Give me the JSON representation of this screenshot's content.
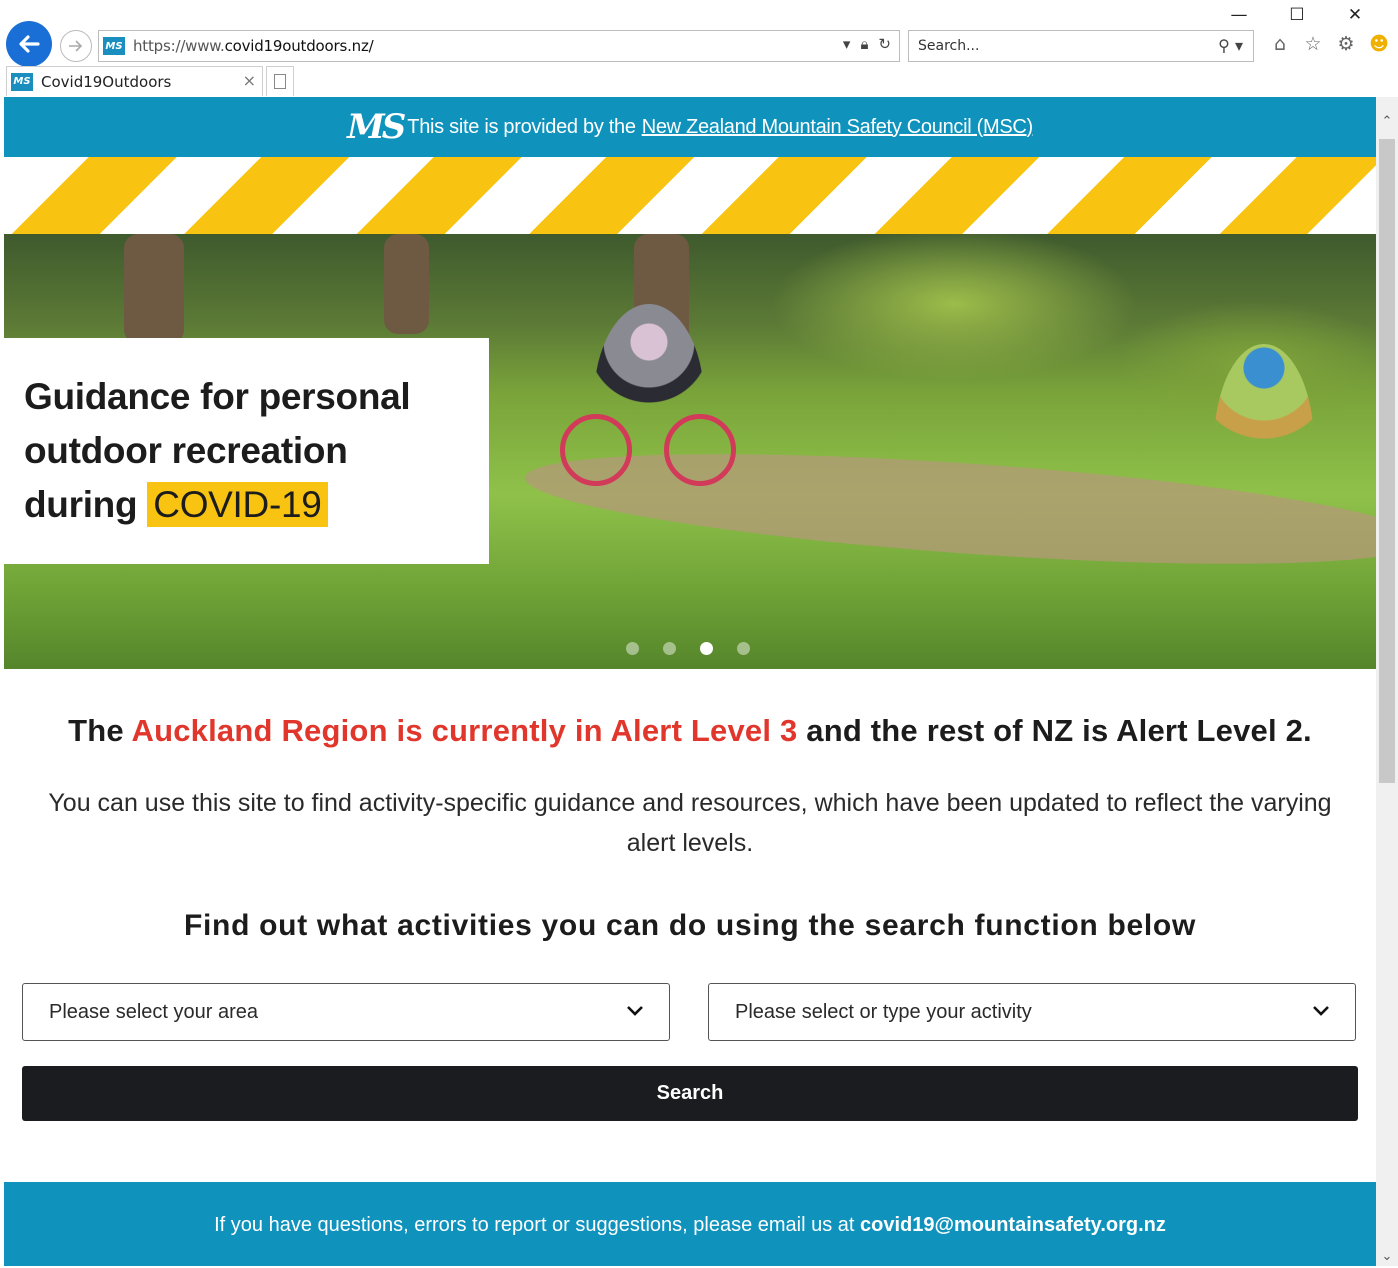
{
  "window": {
    "minimize_glyph": "—",
    "maximize_glyph": "☐",
    "close_glyph": "✕"
  },
  "browser": {
    "url_prefix": "https://www.",
    "url_domain": "covid19outdoors.nz/",
    "search_placeholder": "Search...",
    "tab_title": "Covid19Outdoors",
    "tab_close": "×",
    "favicon_text": "MS",
    "icons": [
      "home-icon",
      "favorites-star-icon",
      "settings-gear-icon",
      "feedback-smiley-icon"
    ]
  },
  "banner": {
    "logo_text": "MS",
    "prefix": "This site is provided by the",
    "link_text": "New Zealand Mountain Safety Council (MSC)"
  },
  "hero": {
    "line1": "Guidance for personal",
    "line2": "outdoor recreation",
    "line3": "during",
    "highlight": "COVID-19",
    "carousel_slides": 4,
    "carousel_active": 3
  },
  "alert": {
    "prefix": "The ",
    "red": "Auckland Region is currently in Alert Level 3",
    "suffix": " and the rest of NZ is Alert Level 2."
  },
  "intro": "You can use this site to find activity-specific guidance and resources, which have been updated to reflect the varying alert levels.",
  "find_heading": "Find out what activities you can do using the search function below",
  "form": {
    "area_placeholder": "Please select your area",
    "activity_placeholder": "Please select or type your activity",
    "search_label": "Search"
  },
  "footer": {
    "text": "If you have questions, errors to report or suggestions, please email us at ",
    "email": "covid19@mountainsafety.org.nz"
  },
  "colors": {
    "brand_blue": "#0f93bd",
    "stripe_yellow": "#f8c411",
    "alert_red": "#e0362b",
    "button_dark": "#1b1c1f"
  }
}
